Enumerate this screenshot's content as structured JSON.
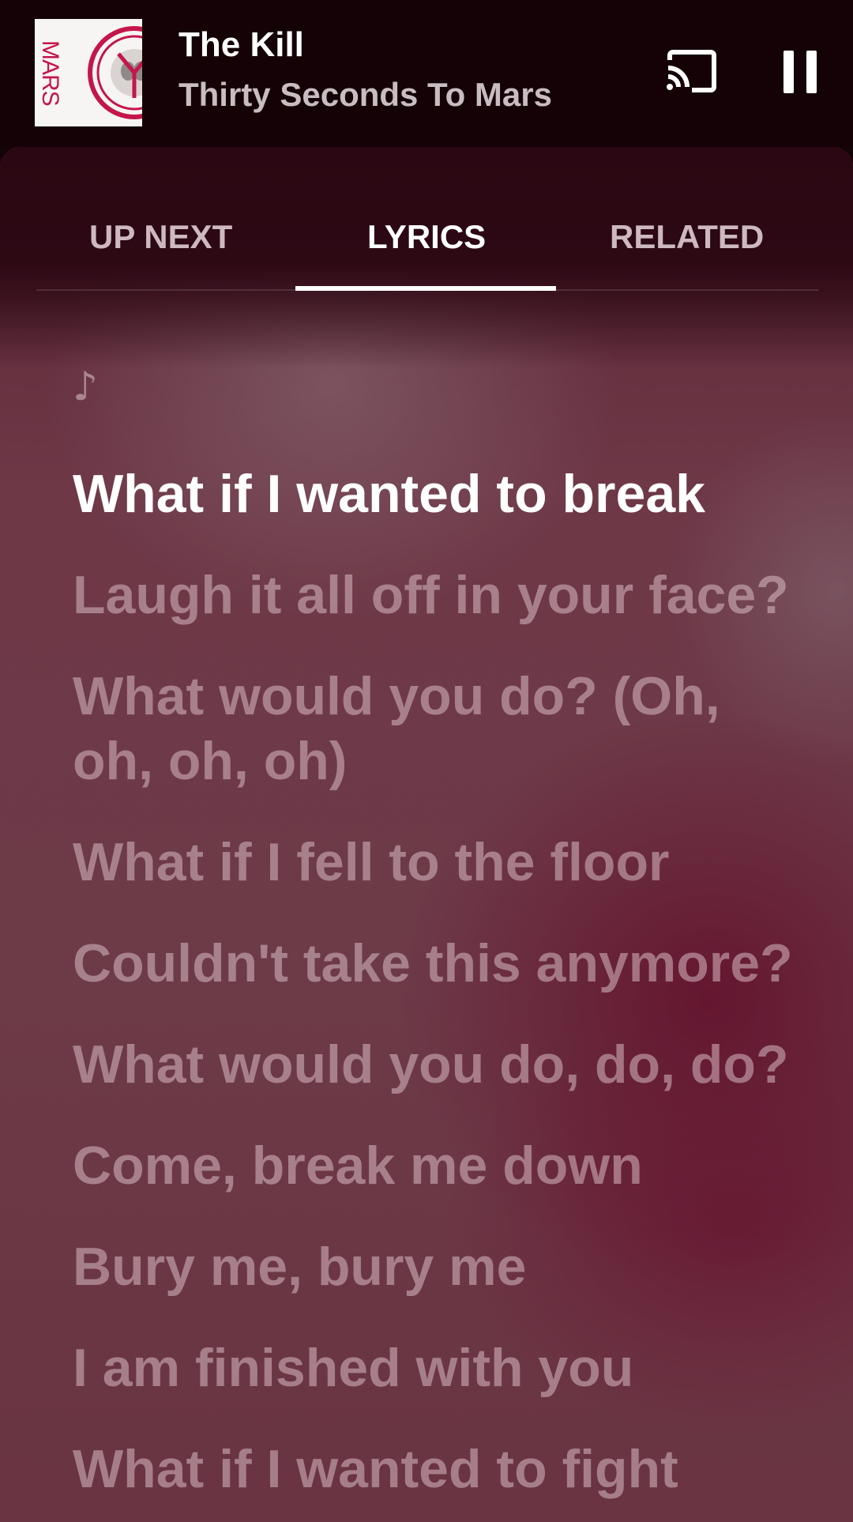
{
  "player": {
    "album_art": {
      "text": "MARS",
      "accent": "#c4164a",
      "icon": "album-cover-triad-seal"
    },
    "title": "The Kill",
    "artist": "Thirty Seconds To Mars",
    "cast_icon": "cast-icon",
    "pause_icon": "pause-icon"
  },
  "tabs": [
    {
      "label": "UP NEXT",
      "active": false
    },
    {
      "label": "LYRICS",
      "active": true
    },
    {
      "label": "RELATED",
      "active": false
    }
  ],
  "lyrics": {
    "intro_icon": "music-note-icon",
    "intro_glyph": "♪",
    "current_line_index": 0,
    "lines": [
      "What if I wanted to break",
      "Laugh it all off in your face?",
      "What would you do? (Oh, oh, oh, oh)",
      "What if I fell to the floor",
      "Couldn't take this anymore?",
      "What would you do, do, do?",
      "Come, break me down",
      "Bury me, bury me",
      "I am finished with you",
      "What if I wanted to fight"
    ]
  },
  "colors": {
    "header_bg": "#140207",
    "accent_active": "#ffffff",
    "inactive_text": "#cdb9bf"
  }
}
